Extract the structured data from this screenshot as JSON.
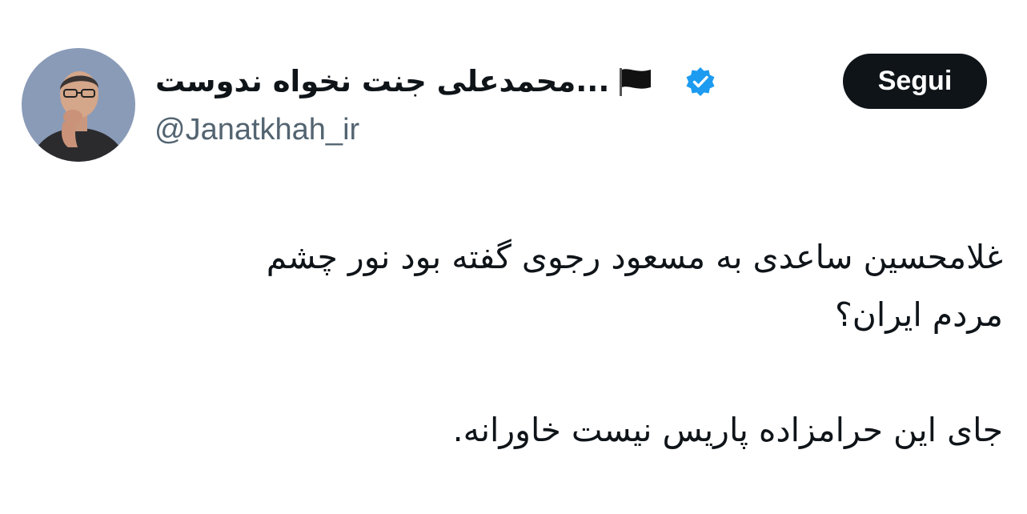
{
  "author": {
    "display_name": "محمدعلی جنت نخواه ندوست...",
    "handle": "@Janatkhah_ir",
    "avatar_icon": "user-avatar-photo",
    "flag_icon": "black-flag-icon",
    "verified_icon": "verified-badge-icon",
    "verified_color": "#1d9bf0"
  },
  "follow_button": {
    "label": "Segui"
  },
  "tweet": {
    "lines": [
      "غلامحسین ساعدی به مسعود رجوی گفته بود نور چشم",
      "مردم ایران؟",
      "جای این حرامزاده پاریس نیست خاورانه."
    ]
  },
  "colors": {
    "text": "#0f1419",
    "secondary_text": "#536471",
    "button_bg": "#0f1419",
    "button_text": "#ffffff",
    "background": "#ffffff"
  }
}
